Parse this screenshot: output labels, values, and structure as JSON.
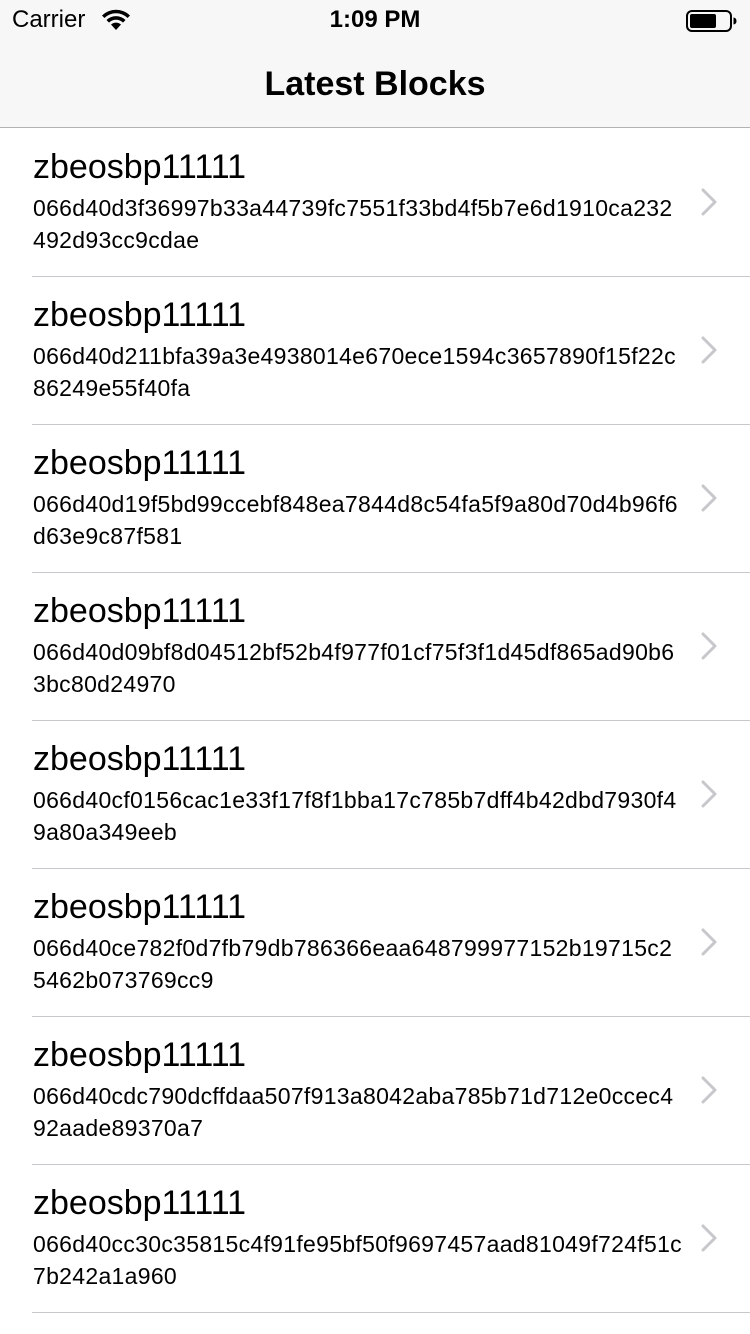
{
  "status_bar": {
    "carrier": "Carrier",
    "time": "1:09 PM",
    "wifi_icon": "wifi-icon",
    "battery_icon": "battery-icon"
  },
  "nav": {
    "title": "Latest Blocks"
  },
  "rows": [
    {
      "title": "zbeosbp11111",
      "subtitle": "066d40d3f36997b33a44739fc7551f33bd4f5b7e6d1910ca232492d93cc9cdae"
    },
    {
      "title": "zbeosbp11111",
      "subtitle": "066d40d211bfa39a3e4938014e670ece1594c3657890f15f22c86249e55f40fa"
    },
    {
      "title": "zbeosbp11111",
      "subtitle": "066d40d19f5bd99ccebf848ea7844d8c54fa5f9a80d70d4b96f6d63e9c87f581"
    },
    {
      "title": "zbeosbp11111",
      "subtitle": "066d40d09bf8d04512bf52b4f977f01cf75f3f1d45df865ad90b63bc80d24970"
    },
    {
      "title": "zbeosbp11111",
      "subtitle": "066d40cf0156cac1e33f17f8f1bba17c785b7dff4b42dbd7930f49a80a349eeb"
    },
    {
      "title": "zbeosbp11111",
      "subtitle": "066d40ce782f0d7fb79db786366eaa648799977152b19715c25462b073769cc9"
    },
    {
      "title": "zbeosbp11111",
      "subtitle": "066d40cdc790dcffdaa507f913a8042aba785b71d712e0ccec492aade89370a7"
    },
    {
      "title": "zbeosbp11111",
      "subtitle": "066d40cc30c35815c4f91fe95bf50f9697457aad81049f724f51c7b242a1a960"
    }
  ],
  "colors": {
    "nav_background": "#f7f7f7",
    "separator": "#c8c7cc",
    "chevron": "#c7c7cc"
  }
}
